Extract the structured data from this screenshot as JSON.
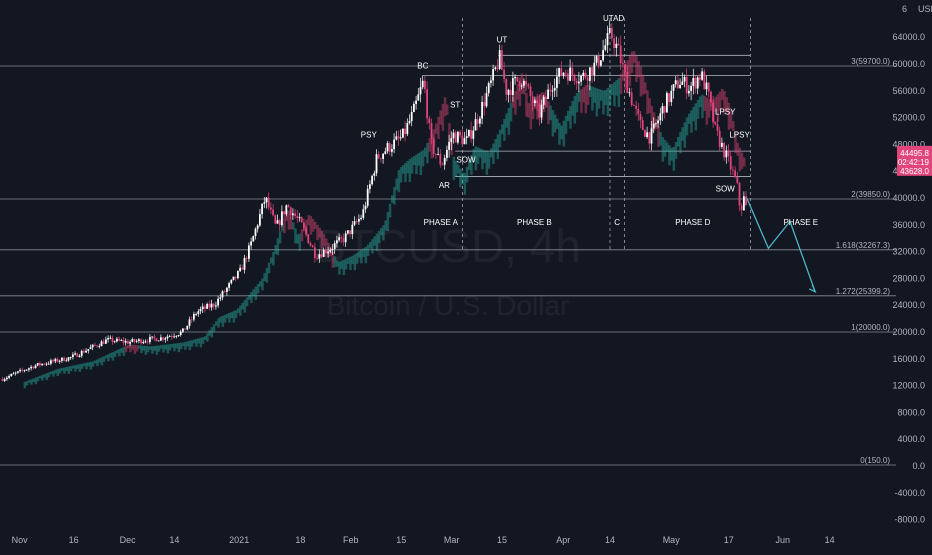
{
  "currency": "USD",
  "watermark": {
    "title": "BTCUSD, 4h",
    "subtitle": "Bitcoin / U.S. Dollar"
  },
  "colors": {
    "background": "#131722",
    "bull": "#ffffff",
    "bear": "#e0457b",
    "cloud_bull": "#26a69a",
    "cloud_bear": "#d6456e",
    "projection": "#4fb5c8",
    "line": "#9598a1",
    "badge_price": "#e0457b",
    "badge_low": "#f23672"
  },
  "price_axis": {
    "top_label": "6",
    "ticks": [
      "64000.0",
      "60000.0",
      "56000.0",
      "52000.0",
      "48000.0",
      "44000.0",
      "40000.0",
      "36000.0",
      "32000.0",
      "28000.0",
      "24000.0",
      "20000.0",
      "16000.0",
      "12000.0",
      "8000.0",
      "4000.0",
      "0.0",
      "-4000.0",
      "-8000.0"
    ],
    "badges": {
      "price": "44495.8",
      "countdown": "02:42:19",
      "low": "43628.0"
    }
  },
  "time_axis": {
    "labels": [
      "Nov",
      "16",
      "Dec",
      "14",
      "2021",
      "18",
      "Feb",
      "15",
      "Mar",
      "15",
      "Apr",
      "14",
      "May",
      "17",
      "Jun",
      "14"
    ]
  },
  "fib_levels": [
    {
      "label": "3(59700.0)",
      "value": 59700
    },
    {
      "label": "2(39850.0)",
      "value": 39850
    },
    {
      "label": "1.618(32267.3)",
      "value": 32267.3
    },
    {
      "label": "1.272(25399.2)",
      "value": 25399.2
    },
    {
      "label": "1(20000.0)",
      "value": 20000
    },
    {
      "label": "0(150.0)",
      "value": 150
    }
  ],
  "annotations": {
    "psy": "PSY",
    "bc": "BC",
    "st": "ST",
    "ar": "AR",
    "sow1": "SOW",
    "ut": "UT",
    "utad": "UTAD",
    "lpsy1": "LPSY",
    "lpsy2": "LPSY",
    "sow2": "SOW"
  },
  "phases": {
    "a": "PHASE A",
    "b": "PHASE B",
    "c": "C",
    "d": "PHASE D",
    "e": "PHASE E"
  },
  "chart_data": {
    "type": "line",
    "title": "BTCUSD, 4h",
    "subtitle": "Bitcoin / U.S. Dollar",
    "xlabel": "",
    "ylabel": "",
    "y_range": [
      -10000,
      67000
    ],
    "x_range": [
      "2020-10-27",
      "2021-06-20"
    ],
    "series": [
      {
        "values_meta": "approximate close prices read from the chart",
        "x": [
          "2020-10-27",
          "2020-11-05",
          "2020-11-15",
          "2020-11-25",
          "2020-12-01",
          "2020-12-10",
          "2020-12-16",
          "2020-12-20",
          "2020-12-25",
          "2021-01-01",
          "2021-01-04",
          "2021-01-08",
          "2021-01-11",
          "2021-01-14",
          "2021-01-18",
          "2021-01-22",
          "2021-01-26",
          "2021-01-30",
          "2021-02-04",
          "2021-02-08",
          "2021-02-11",
          "2021-02-15",
          "2021-02-18",
          "2021-02-21",
          "2021-02-23",
          "2021-02-26",
          "2021-03-01",
          "2021-03-05",
          "2021-03-08",
          "2021-03-12",
          "2021-03-14",
          "2021-03-16",
          "2021-03-20",
          "2021-03-25",
          "2021-03-29",
          "2021-04-01",
          "2021-04-06",
          "2021-04-10",
          "2021-04-14",
          "2021-04-16",
          "2021-04-19",
          "2021-04-22",
          "2021-04-25",
          "2021-04-29",
          "2021-05-03",
          "2021-05-06",
          "2021-05-09",
          "2021-05-11",
          "2021-05-13",
          "2021-05-15",
          "2021-05-17",
          "2021-05-19",
          "2021-05-20",
          "2021-05-21",
          "2021-05-22"
        ],
        "values": [
          13000,
          15000,
          16200,
          18800,
          18500,
          19100,
          20000,
          23000,
          24200,
          29000,
          33000,
          40000,
          35500,
          39000,
          36000,
          31500,
          32500,
          34000,
          37500,
          46000,
          47500,
          49000,
          52500,
          57500,
          48000,
          45000,
          49500,
          48500,
          52000,
          57500,
          61000,
          56000,
          58000,
          52500,
          57500,
          59000,
          58000,
          60000,
          64500,
          62000,
          56000,
          51000,
          49000,
          54000,
          57500,
          56500,
          58500,
          55500,
          50000,
          47500,
          45000,
          42000,
          38000,
          40000,
          37500
        ]
      },
      {
        "name": "Projection",
        "x": [
          "2021-05-22",
          "2021-05-28",
          "2021-06-03",
          "2021-06-10"
        ],
        "values": [
          40000,
          32500,
          36500,
          26000
        ]
      }
    ]
  }
}
